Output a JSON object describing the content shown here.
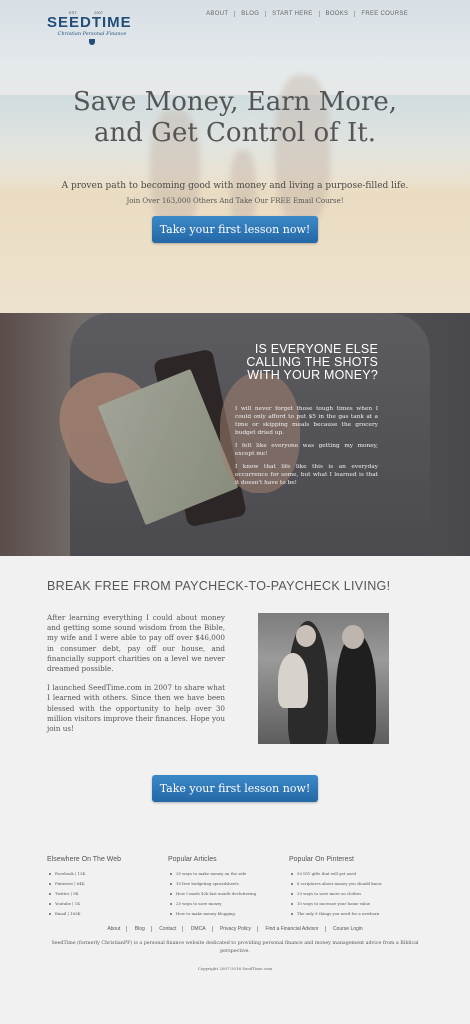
{
  "header": {
    "logo": {
      "est": "EST.",
      "year": "2007",
      "brand": "SEEDTIME",
      "tagline": "Christian Personal Finance"
    },
    "nav": [
      "ABOUT",
      "BLOG",
      "START HERE",
      "BOOKS",
      "FREE COURSE"
    ]
  },
  "hero": {
    "title_line1": "Save Money, Earn More,",
    "title_line2": "and Get Control of It.",
    "lead": "A proven path to becoming good with money and living a purpose-filled life.",
    "join": "Join Over 163,000 Others And Take Our FREE Email Course!",
    "cta": "Take your first lesson now!"
  },
  "wallet_section": {
    "heading_line1": "IS EVERYONE ELSE",
    "heading_line2": "CALLING THE SHOTS",
    "heading_line3": "WITH YOUR MONEY?",
    "paragraphs": [
      "I will never forget those tough times when I could only afford to put $5 in the gas tank at a time or skipping meals because the grocery budget dried up.",
      "I felt like everyone was getting my money, except me!",
      "I know that life like this is an everyday occurrence for some, but what I learned is that it doesn't have to be!"
    ]
  },
  "story": {
    "heading": "BREAK FREE FROM PAYCHECK-TO-PAYCHECK LIVING!",
    "paragraphs": [
      "After learning everything I could about money and getting some sound wisdom from the Bible, my wife and I were able to pay off over $46,000 in consumer debt, pay off our house, and financially support charities on a level we never dreamed possible.",
      "I launched SeedTime.com in 2007 to share what I learned with others. Since then we have been blessed with the opportunity to help over 30 million visitors improve their finances. Hope you join us!"
    ],
    "cta": "Take your first lesson now!"
  },
  "footer": {
    "columns": [
      {
        "title": "Elsewhere On The Web",
        "items": [
          "Facebook | 13K",
          "Pinterest | 64K",
          "Twitter | 9K",
          "Youtube | 1K",
          "Email | 163K"
        ]
      },
      {
        "title": "Popular Articles",
        "items": [
          "35 ways to make money on the side",
          "10 free budgeting spreadsheets",
          "How I made $2k last month decluttering",
          "25 ways to save money",
          "How to make money blogging"
        ]
      },
      {
        "title": "Popular On Pinterest",
        "items": [
          "50 DIY gifts that will get used",
          "8 scriptures about money you should know",
          "20 ways to save more on clothes",
          "10 ways to increase your home value",
          "The only 8 things you need for a newborn"
        ]
      }
    ],
    "links": [
      "About",
      "Blog",
      "Contact",
      "DMCA",
      "Privacy Policy",
      "Find a Financial Advisor",
      "Course Login"
    ],
    "description": "SeedTime (formerly ChristianPF) is a personal finance website dedicated to providing personal finance and money management advice from a Biblical perspective.",
    "copyright": "Copyright 2007-2016 SeedTime.com"
  },
  "colors": {
    "accent": "#2a6fb0",
    "brand": "#234e7a",
    "text": "#555555"
  }
}
